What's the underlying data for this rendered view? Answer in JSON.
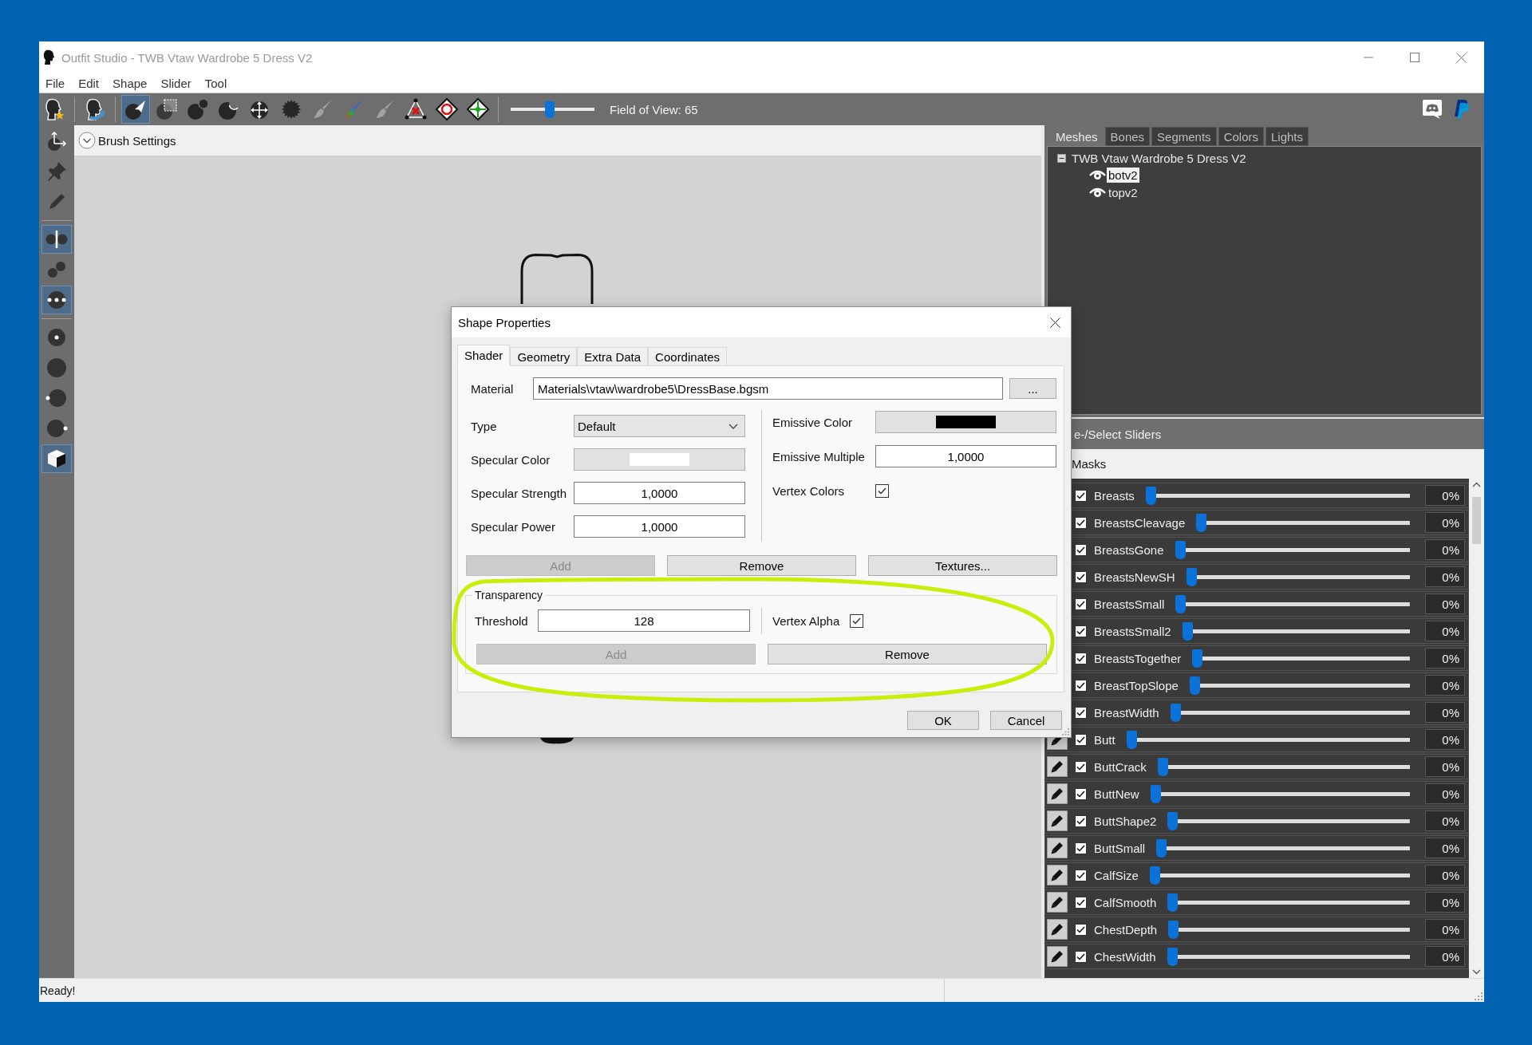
{
  "window": {
    "title": "Outfit Studio - TWB Vtaw Wardrobe 5 Dress V2"
  },
  "menu": [
    "File",
    "Edit",
    "Shape",
    "Slider",
    "Tool"
  ],
  "toolbar": {
    "groups": [
      [
        {
          "kind": "outfit",
          "selected": false,
          "disabled": false
        }
      ],
      [
        {
          "kind": "reference",
          "selected": false,
          "disabled": false
        }
      ],
      [
        {
          "kind": "select",
          "selected": true,
          "disabled": false
        },
        {
          "kind": "mask",
          "selected": false,
          "disabled": false
        },
        {
          "kind": "inflate",
          "selected": false,
          "disabled": false
        },
        {
          "kind": "deflate",
          "selected": false,
          "disabled": false
        },
        {
          "kind": "move",
          "selected": false,
          "disabled": false
        },
        {
          "kind": "smooth",
          "selected": false,
          "disabled": false
        },
        {
          "kind": "brush",
          "selected": false,
          "disabled": true
        },
        {
          "kind": "colorbrush",
          "selected": false,
          "disabled": false
        },
        {
          "kind": "brush",
          "selected": false,
          "disabled": true
        },
        {
          "kind": "collapse",
          "selected": false,
          "disabled": false
        },
        {
          "kind": "flip",
          "selected": false,
          "disabled": false
        },
        {
          "kind": "split",
          "selected": false,
          "disabled": false
        }
      ]
    ],
    "fov": {
      "level": 0.46
    },
    "fov_label": "Field of View: 65"
  },
  "side_toolbar": {
    "groups": [
      [
        {
          "kind": "axes",
          "selected": false
        },
        {
          "kind": "pin",
          "selected": false
        },
        {
          "kind": "pencil",
          "selected": false
        }
      ],
      [
        {
          "kind": "split",
          "selected": true
        },
        {
          "kind": "pair",
          "selected": false
        },
        {
          "kind": "dots",
          "selected": true
        }
      ],
      [
        {
          "kind": "center",
          "selected": false
        },
        {
          "kind": "disc",
          "selected": false
        },
        {
          "kind": "leftdot",
          "selected": false
        },
        {
          "kind": "rightdot",
          "selected": false
        },
        {
          "kind": "cube",
          "selected": true
        }
      ]
    ]
  },
  "brush_settings": {
    "label": "Brush Settings"
  },
  "dialog": {
    "title": "Shape Properties",
    "tabs": [
      {
        "label": "Shader",
        "selected": true
      },
      {
        "label": "Geometry",
        "selected": false
      },
      {
        "label": "Extra Data",
        "selected": false
      },
      {
        "label": "Coordinates",
        "selected": false
      }
    ],
    "material": {
      "label": "Material",
      "value": "Materials\\vtaw\\wardrobe5\\DressBase.bgsm",
      "browse_button": "..."
    },
    "left_fields": [
      {
        "kind": "select",
        "label": "Type",
        "value": "Default"
      },
      {
        "kind": "color",
        "label": "Specular Color",
        "color": "#ffffff"
      },
      {
        "kind": "number",
        "label": "Specular Strength",
        "value": "1,0000"
      },
      {
        "kind": "number",
        "label": "Specular Power",
        "value": "1,0000"
      }
    ],
    "right_fields": [
      {
        "kind": "color",
        "label": "Emissive Color",
        "color": "#000000"
      },
      {
        "kind": "number",
        "label": "Emissive Multiple",
        "value": "1,0000"
      },
      {
        "kind": "check",
        "label": "Vertex Colors",
        "checked": true
      }
    ],
    "texture_buttons": [
      {
        "label": "Add",
        "disabled": true
      },
      {
        "label": "Remove",
        "disabled": false
      },
      {
        "label": "Textures...",
        "disabled": false
      }
    ],
    "transparency": {
      "title": "Transparency",
      "threshold": {
        "label": "Threshold",
        "value": "128"
      },
      "vertex_alpha": {
        "label": "Vertex Alpha",
        "checked": true
      },
      "buttons": [
        {
          "label": "Add",
          "disabled": true
        },
        {
          "label": "Remove",
          "disabled": false
        }
      ]
    },
    "footer_buttons": [
      "OK",
      "Cancel"
    ]
  },
  "panel": {
    "tabs": [
      {
        "label": "Meshes",
        "selected": true
      },
      {
        "label": "Bones",
        "selected": false
      },
      {
        "label": "Segments",
        "selected": false
      },
      {
        "label": "Colors",
        "selected": false
      },
      {
        "label": "Lights",
        "selected": false
      }
    ],
    "tree": {
      "label": "TWB Vtaw Wardrobe 5 Dress V2",
      "expanded": true,
      "children": [
        {
          "label": "botv2",
          "selected": true
        },
        {
          "label": "topv2",
          "selected": false
        }
      ]
    },
    "deselect_button": "e-/Select Sliders",
    "masks_label": "Masks",
    "sliders": [
      {
        "name": "Breasts",
        "checked": true,
        "level": 0,
        "reading": "0%"
      },
      {
        "name": "BreastsCleavage",
        "checked": true,
        "level": 0,
        "reading": "0%"
      },
      {
        "name": "BreastsGone",
        "checked": true,
        "level": 0,
        "reading": "0%"
      },
      {
        "name": "BreastsNewSH",
        "checked": true,
        "level": 0,
        "reading": "0%"
      },
      {
        "name": "BreastsSmall",
        "checked": true,
        "level": 0,
        "reading": "0%"
      },
      {
        "name": "BreastsSmall2",
        "checked": true,
        "level": 0,
        "reading": "0%"
      },
      {
        "name": "BreastsTogether",
        "checked": true,
        "level": 0,
        "reading": "0%"
      },
      {
        "name": "BreastTopSlope",
        "checked": true,
        "level": 0,
        "reading": "0%"
      },
      {
        "name": "BreastWidth",
        "checked": true,
        "level": 0,
        "reading": "0%"
      },
      {
        "name": "Butt",
        "checked": true,
        "level": 0,
        "reading": "0%"
      },
      {
        "name": "ButtCrack",
        "checked": true,
        "level": 0,
        "reading": "0%"
      },
      {
        "name": "ButtNew",
        "checked": true,
        "level": 0,
        "reading": "0%"
      },
      {
        "name": "ButtShape2",
        "checked": true,
        "level": 0,
        "reading": "0%"
      },
      {
        "name": "ButtSmall",
        "checked": true,
        "level": 0,
        "reading": "0%"
      },
      {
        "name": "CalfSize",
        "checked": true,
        "level": 0,
        "reading": "0%"
      },
      {
        "name": "CalfSmooth",
        "checked": true,
        "level": 0,
        "reading": "0%"
      },
      {
        "name": "ChestDepth",
        "checked": true,
        "level": 0,
        "reading": "0%"
      },
      {
        "name": "ChestWidth",
        "checked": true,
        "level": 0,
        "reading": "0%"
      }
    ]
  },
  "status_bar": {
    "text": "Ready!"
  }
}
